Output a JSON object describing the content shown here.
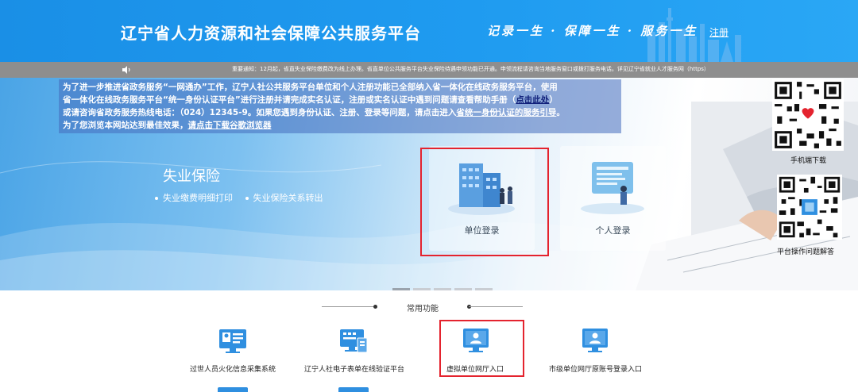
{
  "header": {
    "title": "辽宁省人力资源和社会保障公共服务平台",
    "slogan": "记录一生 · 保障一生 · 服务一生",
    "register_label": "注册"
  },
  "notice": {
    "ticker_text": "重要通知：12月起，省直失业保险缴费改为线上办理。省直单位公共服务平台失业保险待遇申领功能已开通。申领流程请咨询当地服务窗口或拨打服务电话。详见辽宁省就业人才服务网（https）"
  },
  "banner": {
    "info_line1": "为了进一步推进省政务服务“一网通办”工作，辽宁人社公共服务平台单位和个人注册功能已全部纳入省一体化在线政务服务平台，使用",
    "info_line2a": "省一体化在线政务服务平台“统一身份认证平台”进行注册并请完成实名认证，注册或实名认证中遇到问题请查看帮助手册（",
    "info_line2_link": "点击此处",
    "info_line2b": "）",
    "info_line3a": "或请咨询省政务服务热线电话：（024）12345-9。如果您遇到身份认证、注册、登录等问题，请点击进入",
    "info_line3_link": "省统一身份认证的服务引导",
    "info_line3b": "。",
    "info_line4a": "为了您浏览本网站达到最佳效果，",
    "info_line4_link": "请点击下载谷歌浏览器",
    "insurance_title": "失业保险",
    "insurance_links": [
      "失业缴费明细打印",
      "失业保险关系转出"
    ],
    "unit_login_label": "单位登录",
    "person_login_label": "个人登录",
    "slide_count": 5,
    "active_slide": 0
  },
  "qr_panel": {
    "mobile_download_label": "手机端下载",
    "help_label": "平台操作问题解答"
  },
  "common": {
    "section_title": "常用功能",
    "items": [
      {
        "label": "过世人员火化信息采集系统",
        "icon": "id-card-icon"
      },
      {
        "label": "辽宁人社电子表单在线验证平台",
        "icon": "monitor-form-icon"
      },
      {
        "label": "虚拟单位网厅入口",
        "icon": "monitor-user-icon"
      },
      {
        "label": "市级单位网厅原账号登录入口",
        "icon": "monitor-user-icon"
      }
    ]
  },
  "colors": {
    "header_blue": "#1f9bf0",
    "notice_gray": "#8e8e8e",
    "highlight_red": "#e4232e",
    "icon_blue": "#2f8fe0"
  }
}
